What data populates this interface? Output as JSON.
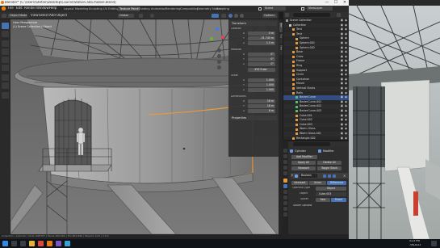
{
  "window": {
    "title": "Blender* [C:\\Users\\Stefan\\Desktop\\Course\\Station.ada.mobile.blend]",
    "controls": [
      "—",
      "☐",
      "✕"
    ]
  },
  "menu": {
    "items": [
      "File",
      "Edit",
      "Render",
      "Window",
      "Help"
    ],
    "workspaces": [
      "Layout",
      "Modeling",
      "Sculpting",
      "UV Editing",
      "Texture Paint",
      "Shading",
      "Animation",
      "Rendering",
      "Compositing",
      "Geometry Nodes",
      "Scripting"
    ],
    "active_workspace": "Layout",
    "scene_label": "Scene",
    "view_layer_label": "ViewLayer"
  },
  "viewport_header": {
    "mode": "Object Mode",
    "menus": [
      "View",
      "Select",
      "Add",
      "Object"
    ],
    "transform_orientation": "Global",
    "options_label": "Options"
  },
  "viewport_overlay": {
    "view_name": "User Perspective",
    "collection_line": "(1) Scene Collection | Object"
  },
  "npanel": {
    "tabs": [
      "Item",
      "Tool",
      "View"
    ],
    "transform_header": "Transform",
    "location_label": "Location",
    "location": [
      {
        "axis": "X",
        "value": "0 m"
      },
      {
        "axis": "Y",
        "value": "-31.745 m"
      },
      {
        "axis": "Z",
        "value": "1.5 m"
      }
    ],
    "rotation_label": "Rotation",
    "rotation": [
      {
        "axis": "X",
        "value": "0°"
      },
      {
        "axis": "Y",
        "value": "0°"
      },
      {
        "axis": "Z",
        "value": "0°"
      }
    ],
    "rotation_mode": "XYZ Euler",
    "scale_label": "Scale",
    "scale": [
      {
        "axis": "X",
        "value": "1.000"
      },
      {
        "axis": "Y",
        "value": "1.000"
      },
      {
        "axis": "Z",
        "value": "1.000"
      }
    ],
    "dimensions_label": "Dimensions",
    "dimensions": [
      {
        "axis": "X",
        "value": "18 m"
      },
      {
        "axis": "Y",
        "value": "18 m"
      },
      {
        "axis": "Z",
        "value": "6 m"
      }
    ],
    "properties_header": "Properties"
  },
  "outliner": {
    "header_search": "",
    "rows": [
      {
        "name": "Scene Collection",
        "depth": 0,
        "color": "#9a9a9a"
      },
      {
        "name": "Collection",
        "depth": 1,
        "color": "#c8c8c8"
      },
      {
        "name": "Tent",
        "depth": 2,
        "color": "#e89a3c"
      },
      {
        "name": "Tent",
        "depth": 2,
        "color": "#e89a3c"
      },
      {
        "name": "Sphere",
        "depth": 3,
        "color": "#e89a3c"
      },
      {
        "name": "Sphere.001",
        "depth": 3,
        "color": "#e89a3c"
      },
      {
        "name": "Sphere.002",
        "depth": 3,
        "color": "#e89a3c"
      },
      {
        "name": "Base",
        "depth": 2,
        "color": "#e89a3c"
      },
      {
        "name": "Cube",
        "depth": 2,
        "color": "#e89a3c"
      },
      {
        "name": "Frame",
        "depth": 2,
        "color": "#e89a3c"
      },
      {
        "name": "Ring",
        "depth": 2,
        "color": "#e89a3c"
      },
      {
        "name": "Support",
        "depth": 2,
        "color": "#e89a3c"
      },
      {
        "name": "Circle",
        "depth": 2,
        "color": "#e89a3c"
      },
      {
        "name": "Container",
        "depth": 2,
        "color": "#e89a3c"
      },
      {
        "name": "Mount",
        "depth": 2,
        "color": "#e89a3c"
      },
      {
        "name": "Vertical Struts",
        "depth": 2,
        "color": "#e89a3c"
      },
      {
        "name": "Rails",
        "depth": 2,
        "color": "#e89a3c"
      },
      {
        "name": "BezierCurve",
        "depth": 3,
        "color": "#56c26a"
      },
      {
        "name": "BezierCurve.001",
        "depth": 3,
        "color": "#56c26a"
      },
      {
        "name": "BezierCurve.002",
        "depth": 3,
        "color": "#56c26a"
      },
      {
        "name": "BezierCurve.003",
        "depth": 3,
        "color": "#56c26a"
      },
      {
        "name": "Cube.001",
        "depth": 3,
        "color": "#e89a3c"
      },
      {
        "name": "Cube.002",
        "depth": 3,
        "color": "#e89a3c"
      },
      {
        "name": "Cube.003",
        "depth": 3,
        "color": "#e89a3c"
      },
      {
        "name": "Warm Glass",
        "depth": 3,
        "color": "#e89a3c"
      },
      {
        "name": "Warm Glass.001",
        "depth": 3,
        "color": "#e89a3c"
      },
      {
        "name": "Rectangle.002",
        "depth": 2,
        "color": "#e89a3c"
      }
    ],
    "selected_index": 17
  },
  "properties": {
    "object_name": "Cylinder",
    "modifier_tab_name": "Modifier",
    "add_modifier_label": "Add Modifier",
    "buttons_row1": [
      "Apply All",
      "Delete All"
    ],
    "buttons_row2": [
      "Viewport",
      "Toggle Stack"
    ],
    "modifier_name": "Boolean",
    "modes": [
      "Intersect",
      "Union",
      "Difference"
    ],
    "active_mode": "Difference",
    "operand_type_label": "Operand Type",
    "operand_type_value": "Object",
    "object_label": "Object",
    "object_value": "Cube.003",
    "solver_label": "Solver",
    "solvers": [
      "Fast",
      "Exact"
    ],
    "active_solver": "Exact",
    "solver_options_label": "Solver Options"
  },
  "statusbar": {
    "text": "Collection | Cylinder | Verts 408,567 | Faces 402,009 | Tris 802,866 | Objects 1/24 | 3.3.0"
  },
  "taskbar": {
    "time": "5:23 PM",
    "date": "7/9/2023"
  },
  "colors": {
    "accent_blue": "#4772b3",
    "orange_object": "#e89a3c",
    "bg_dark": "#1d1d1d",
    "viewport_grey": "#6e6e6e"
  }
}
